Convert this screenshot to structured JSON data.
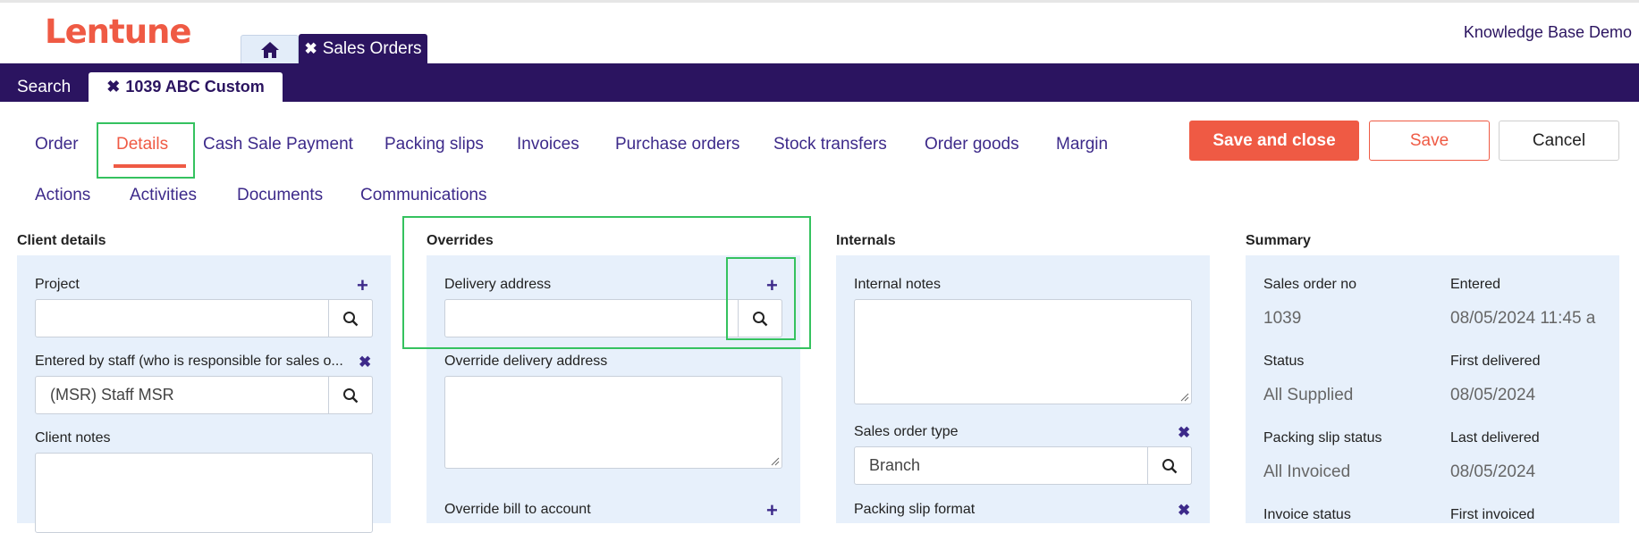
{
  "app": {
    "logo": "Lentune",
    "user_label": "Knowledge Base Demo"
  },
  "top_tabs": {
    "module_label": "Sales Orders"
  },
  "navbar": {
    "search_label": "Search",
    "record_tab_label": "1039 ABC Custom"
  },
  "subtabs": [
    "Order",
    "Details",
    "Cash Sale Payment",
    "Packing slips",
    "Invoices",
    "Purchase orders",
    "Stock transfers",
    "Order goods",
    "Margin",
    "Actions",
    "Activities",
    "Documents",
    "Communications"
  ],
  "active_subtab": "Details",
  "actions": {
    "save_close": "Save and close",
    "save": "Save",
    "cancel": "Cancel"
  },
  "client_details": {
    "title": "Client details",
    "project_label": "Project",
    "project_value": "",
    "entered_by_label": "Entered by staff (who is responsible for sales o...",
    "entered_by_value": "(MSR) Staff MSR",
    "client_notes_label": "Client notes"
  },
  "overrides": {
    "title": "Overrides",
    "delivery_address_label": "Delivery address",
    "delivery_address_value": "",
    "override_delivery_label": "Override delivery address",
    "override_bill_label": "Override bill to account"
  },
  "internals": {
    "title": "Internals",
    "internal_notes_label": "Internal notes",
    "sales_order_type_label": "Sales order type",
    "sales_order_type_value": "Branch",
    "packing_slip_format_label": "Packing slip format"
  },
  "summary": {
    "title": "Summary",
    "items": [
      {
        "label": "Sales order no",
        "value": "1039"
      },
      {
        "label": "Entered",
        "value": "08/05/2024 11:45 a"
      },
      {
        "label": "Status",
        "value": "All Supplied"
      },
      {
        "label": "First delivered",
        "value": "08/05/2024"
      },
      {
        "label": "Packing slip status",
        "value": "All Invoiced"
      },
      {
        "label": "Last delivered",
        "value": "08/05/2024"
      },
      {
        "label": "Invoice status",
        "value": ""
      },
      {
        "label": "First invoiced",
        "value": ""
      }
    ]
  },
  "colors": {
    "brand": "#ef5a44",
    "nav": "#2b1460",
    "link": "#3d2a8a",
    "panel": "#e7f0fb",
    "highlight": "#35c25f"
  }
}
